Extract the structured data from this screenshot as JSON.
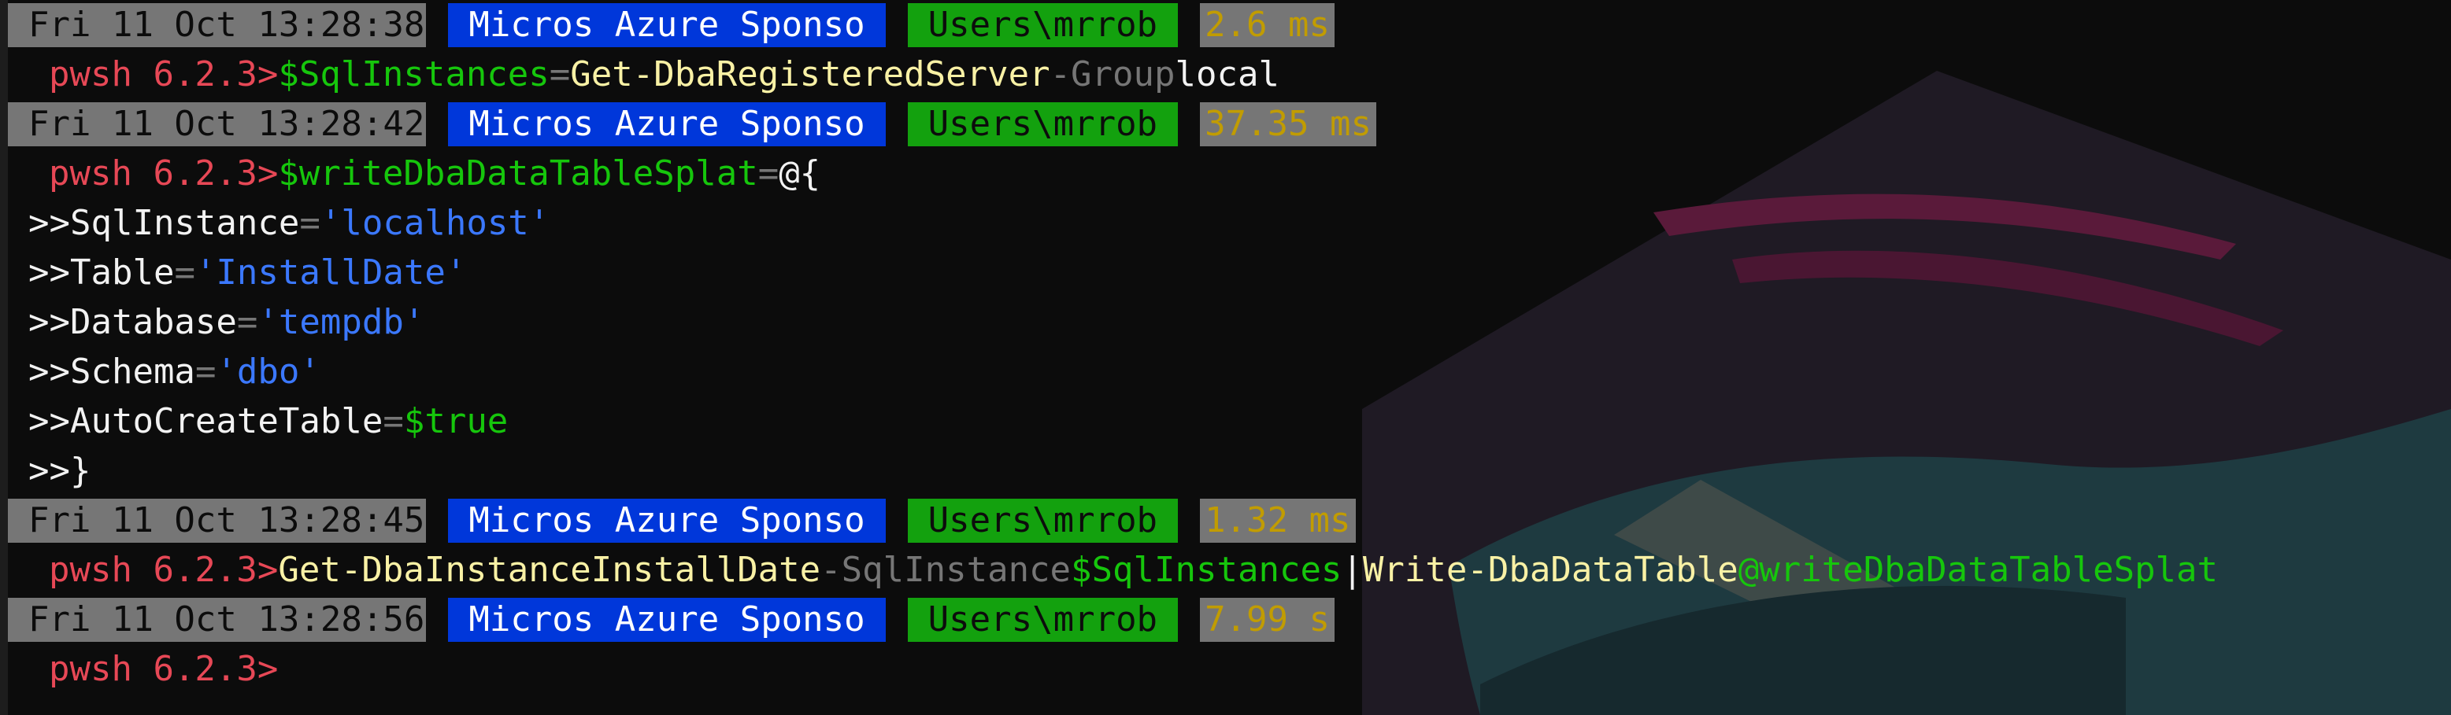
{
  "theme": {
    "background": "#0c0c0c",
    "prompt_color": "#e74856",
    "variable_color": "#16c60c",
    "command_color": "#f9f1a5",
    "string_color": "#3b78ff",
    "param_color": "#767676"
  },
  "status_lines": [
    {
      "date": "Fri 11 Oct 13:28:38",
      "host": "Micros Azure Sponso",
      "user": "Users\\mrrob",
      "elapsed": "2.6 ms"
    },
    {
      "date": "Fri 11 Oct 13:28:42",
      "host": "Micros Azure Sponso",
      "user": "Users\\mrrob",
      "elapsed": "37.35 ms"
    },
    {
      "date": "Fri 11 Oct 13:28:45",
      "host": "Micros Azure Sponso",
      "user": "Users\\mrrob",
      "elapsed": "1.32 ms"
    },
    {
      "date": "Fri 11 Oct 13:28:56",
      "host": "Micros Azure Sponso",
      "user": "Users\\mrrob",
      "elapsed": "7.99 s"
    }
  ],
  "prompt": "pwsh 6.2.3>",
  "command1": {
    "var": "$SqlInstances",
    "eq": "=",
    "cmd": "Get-DbaRegisteredServer",
    "param": "-Group",
    "value": "local"
  },
  "command2": {
    "var": "$writeDbaDataTableSplat",
    "eq": "=",
    "open": "@{",
    "continuation": ">>",
    "entries": [
      {
        "key": "SqlInstance",
        "eq": "=",
        "value": "'localhost'"
      },
      {
        "key": "Table",
        "eq": "=",
        "value": "'InstallDate'"
      },
      {
        "key": "Database",
        "eq": "=",
        "value": "'tempdb'"
      },
      {
        "key": "Schema",
        "eq": "=",
        "value": "'dbo'"
      },
      {
        "key": "AutoCreateTable",
        "eq": "=",
        "value": "$true"
      }
    ],
    "close": "}"
  },
  "command3": {
    "cmd": "Get-DbaInstanceInstallDate",
    "param": "-SqlInstance",
    "var": "$SqlInstances",
    "pipe": "|",
    "cmd2": "Write-DbaDataTable",
    "splat": "@writeDbaDataTableSplat"
  }
}
